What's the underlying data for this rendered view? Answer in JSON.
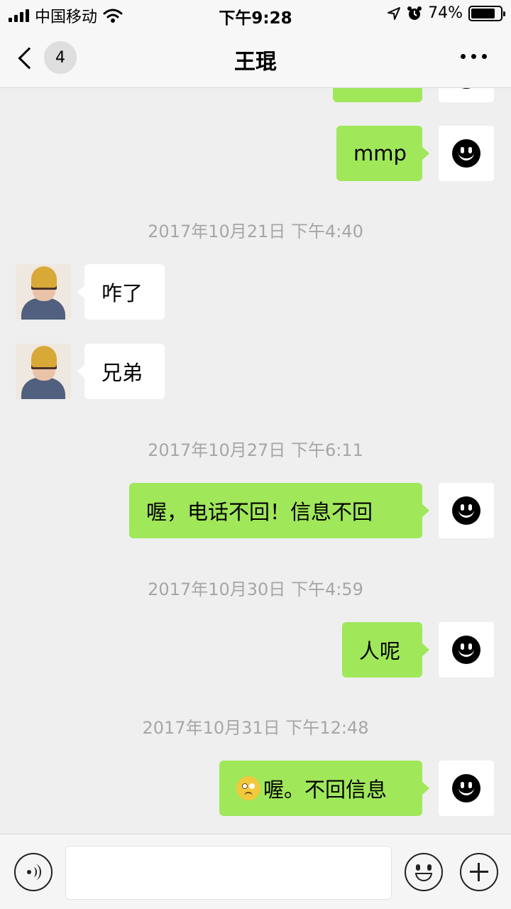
{
  "status_bar": {
    "carrier": "中国移动",
    "time": "下午9:28",
    "battery_percent": "74%",
    "battery_level": 0.74
  },
  "nav": {
    "back_badge": "4",
    "title": "王琨",
    "more_icon": "more-dots-icon"
  },
  "messages": [
    {
      "type": "bubble",
      "side": "self",
      "text": "",
      "partial": true
    },
    {
      "type": "bubble",
      "side": "self",
      "text": "mmp"
    },
    {
      "type": "timestamp",
      "text": "2017年10月21日 下午4:40"
    },
    {
      "type": "bubble",
      "side": "other",
      "text": "咋了"
    },
    {
      "type": "bubble",
      "side": "other",
      "text": "兄弟"
    },
    {
      "type": "timestamp",
      "text": "2017年10月27日 下午6:11"
    },
    {
      "type": "bubble",
      "side": "self",
      "text": "喔，电话不回！信息不回"
    },
    {
      "type": "timestamp",
      "text": "2017年10月30日 下午4:59"
    },
    {
      "type": "bubble",
      "side": "self",
      "text": "人呢"
    },
    {
      "type": "timestamp",
      "text": "2017年10月31日 下午12:48"
    },
    {
      "type": "bubble",
      "side": "self",
      "text": "喔。不回信息",
      "emoji": "thinking-face-emoji"
    }
  ],
  "input_bar": {
    "voice_icon": "voice-icon",
    "input_value": "",
    "emoji_icon": "emoji-face-icon",
    "plus_icon": "plus-icon"
  },
  "colors": {
    "self_bubble": "#a0e75a",
    "other_bubble": "#ffffff",
    "chat_background": "#efefef"
  }
}
